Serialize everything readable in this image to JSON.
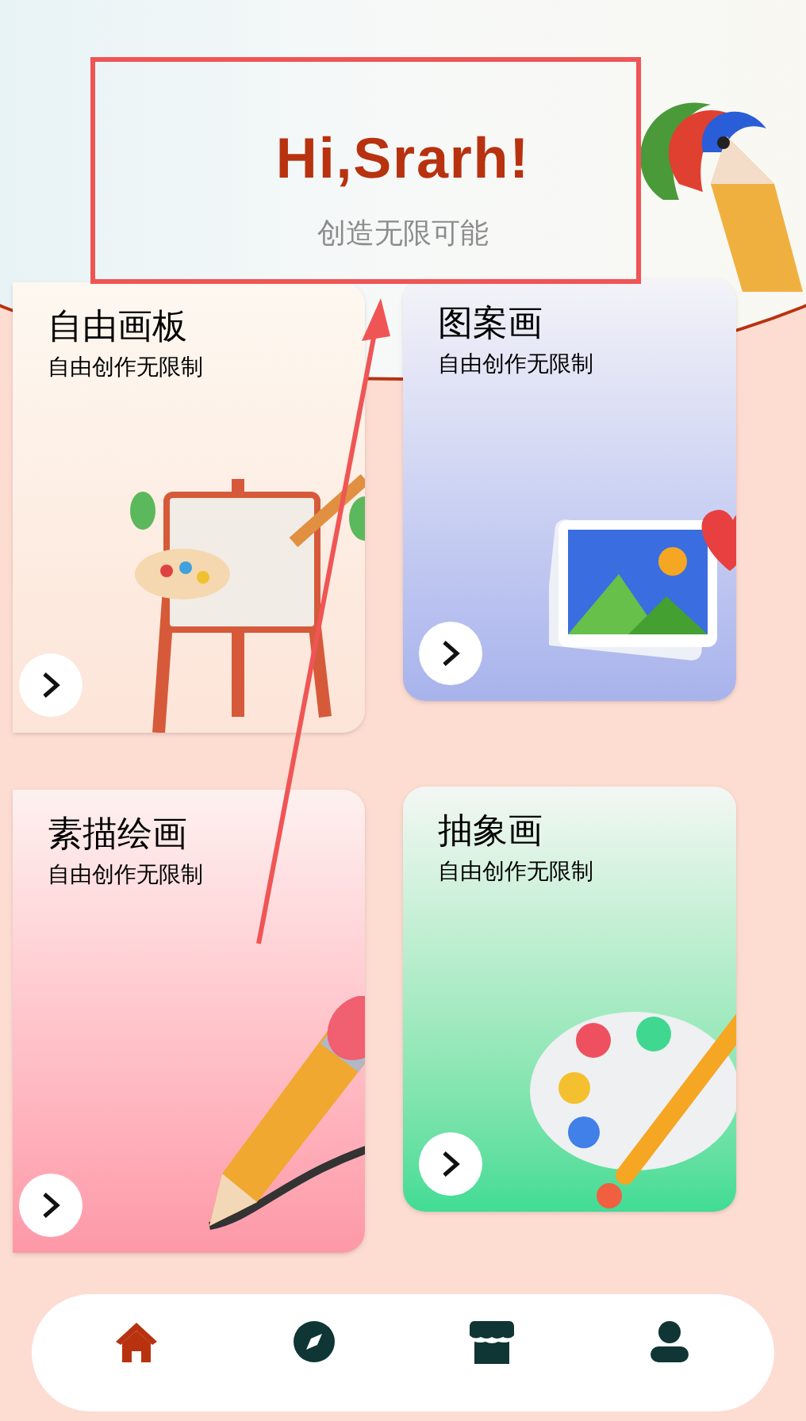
{
  "header": {
    "greeting": "Hi,Srarh!",
    "tagline": "创造无限可能"
  },
  "cards": [
    {
      "kind": "easel",
      "title": "自由画板",
      "subtitle": "自由创作无限制"
    },
    {
      "kind": "picture",
      "title": "图案画",
      "subtitle": "自由创作无限制"
    },
    {
      "kind": "pencil",
      "title": "素描绘画",
      "subtitle": "自由创作无限制"
    },
    {
      "kind": "palette",
      "title": "抽象画",
      "subtitle": "自由创作无限制"
    }
  ],
  "nav": [
    {
      "kind": "home",
      "selected": true
    },
    {
      "kind": "explore",
      "selected": false
    },
    {
      "kind": "shop",
      "selected": false
    },
    {
      "kind": "profile",
      "selected": false
    }
  ]
}
